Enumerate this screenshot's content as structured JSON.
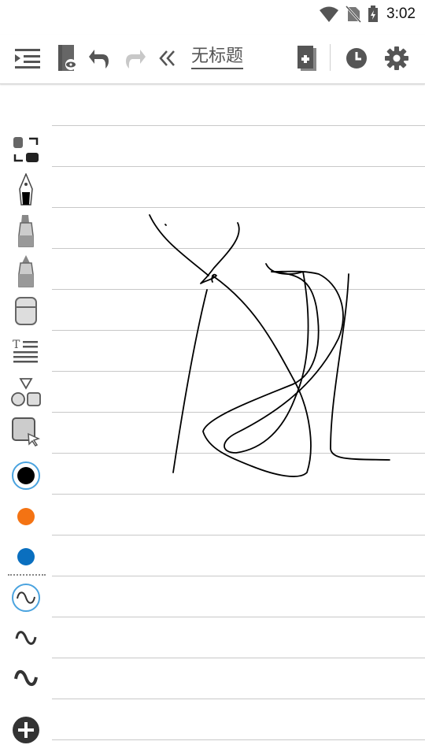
{
  "status": {
    "time": "3:02"
  },
  "toolbar": {
    "title": "无标题"
  },
  "colors": {
    "accent": "#4aa3df",
    "orange": "#f47313",
    "blue": "#0a6fbf",
    "black": "#000000"
  },
  "tools": [
    "layout-toggle",
    "fountain-pen",
    "marker",
    "highlighter",
    "eraser",
    "text",
    "shapes",
    "lasso-select"
  ],
  "pen_colors": [
    "black",
    "orange",
    "blue"
  ],
  "stroke_widths": [
    "thin",
    "medium",
    "thick"
  ]
}
